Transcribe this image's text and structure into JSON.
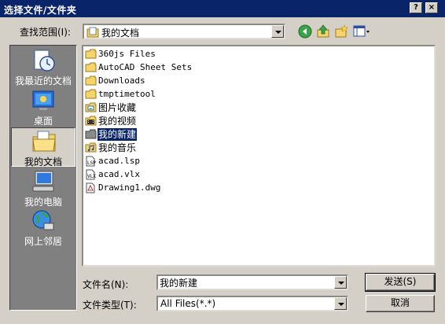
{
  "window": {
    "title": "选择文件/文件夹",
    "help_label": "?",
    "close_label": "×"
  },
  "lookin": {
    "label": "查找范围(I):",
    "value": "我的文档"
  },
  "toolbar_icons": [
    "back-icon",
    "up-folder-icon",
    "new-folder-icon",
    "view-menu-icon"
  ],
  "places": [
    {
      "label": "我最近的文档",
      "icon": "recent-documents-icon",
      "active": false
    },
    {
      "label": "桌面",
      "icon": "desktop-icon",
      "active": false
    },
    {
      "label": "我的文档",
      "icon": "my-documents-icon",
      "active": true
    },
    {
      "label": "我的电脑",
      "icon": "my-computer-icon",
      "active": false
    },
    {
      "label": "网上邻居",
      "icon": "network-places-icon",
      "active": false
    }
  ],
  "files": [
    {
      "name": "360js Files",
      "icon": "folder-icon"
    },
    {
      "name": "AutoCAD Sheet Sets",
      "icon": "folder-icon"
    },
    {
      "name": "Downloads",
      "icon": "folder-icon"
    },
    {
      "name": "tmptimetool",
      "icon": "folder-icon"
    },
    {
      "name": "图片收藏",
      "icon": "picture-folder-icon"
    },
    {
      "name": "我的视频",
      "icon": "video-folder-icon"
    },
    {
      "name": "我的新建",
      "icon": "folder-icon",
      "selected": true
    },
    {
      "name": "我的音乐",
      "icon": "music-folder-icon"
    },
    {
      "name": "acad.lsp",
      "icon": "lsp-file-icon"
    },
    {
      "name": "acad.vlx",
      "icon": "vlx-file-icon"
    },
    {
      "name": "Drawing1.dwg",
      "icon": "dwg-file-icon"
    }
  ],
  "filename": {
    "label": "文件名(N):",
    "value": "我的新建"
  },
  "filetype": {
    "label": "文件类型(T):",
    "value": "All Files(*.*)"
  },
  "buttons": {
    "send": "发送(S)",
    "cancel": "取消"
  },
  "colors": {
    "titlebar": "#0a246a",
    "face": "#d4d0c8",
    "places_bar": "#808080",
    "selection": "#0a246a"
  }
}
